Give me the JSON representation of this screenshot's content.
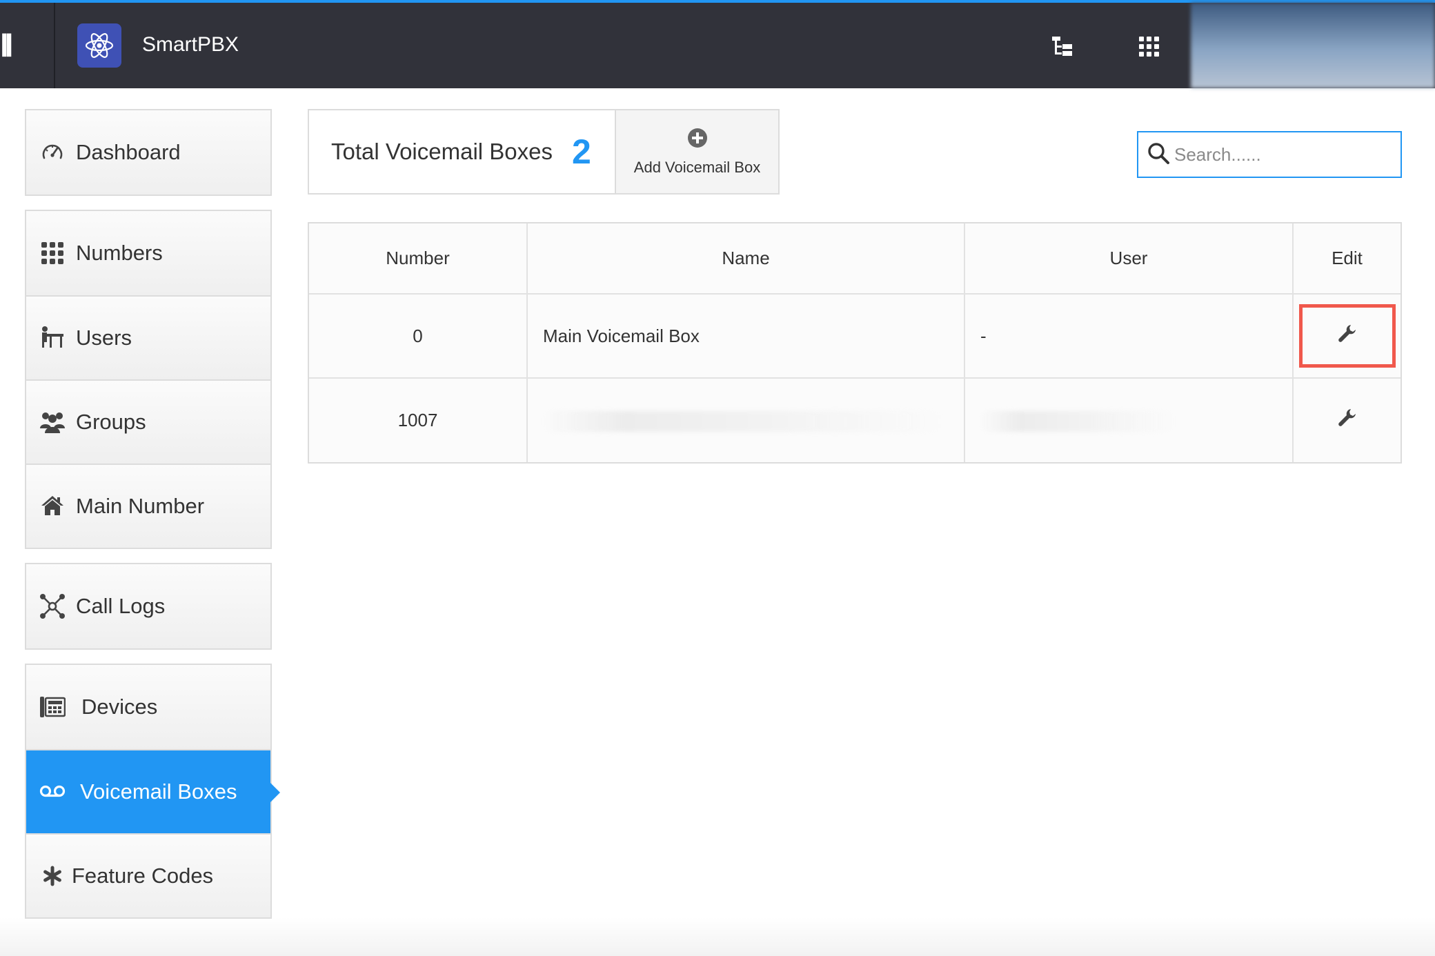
{
  "header": {
    "app_title": "SmartPBX",
    "edge_glyph": "ll",
    "icons": {
      "app": "atom-icon",
      "tree": "tree-structure-icon",
      "apps": "app-grid-icon"
    },
    "accent_color": "#2196f3",
    "bar_color": "#31323a"
  },
  "sidebar": {
    "groups": [
      [
        {
          "id": "dashboard",
          "label": "Dashboard",
          "icon": "speedometer-icon"
        }
      ],
      [
        {
          "id": "numbers",
          "label": "Numbers",
          "icon": "dots-grid-icon"
        },
        {
          "id": "users",
          "label": "Users",
          "icon": "users-desk-icon"
        },
        {
          "id": "groups",
          "label": "Groups",
          "icon": "group-icon"
        },
        {
          "id": "main-number",
          "label": "Main Number",
          "icon": "home-icon"
        }
      ],
      [
        {
          "id": "call-logs",
          "label": "Call Logs",
          "icon": "network-icon"
        }
      ],
      [
        {
          "id": "devices",
          "label": "Devices",
          "icon": "desk-phone-icon"
        },
        {
          "id": "voicemail-boxes",
          "label": "Voicemail Boxes",
          "icon": "voicemail-icon",
          "active": true
        },
        {
          "id": "feature-codes",
          "label": "Feature Codes",
          "icon": "asterisk-icon"
        }
      ]
    ]
  },
  "summary": {
    "total_label": "Total Voicemail Boxes",
    "total_count": "2",
    "add_label": "Add Voicemail Box",
    "add_icon": "plus-circle-icon"
  },
  "search": {
    "placeholder": "Search......",
    "value": "",
    "icon": "search-icon"
  },
  "table": {
    "columns": [
      "Number",
      "Name",
      "User",
      "Edit"
    ],
    "rows": [
      {
        "number": "0",
        "name": "Main Voicemail Box",
        "user": "-",
        "highlight": true
      },
      {
        "number": "1007",
        "name": "",
        "user": "",
        "redacted": true
      }
    ],
    "edit_icon": "wrench-icon"
  }
}
